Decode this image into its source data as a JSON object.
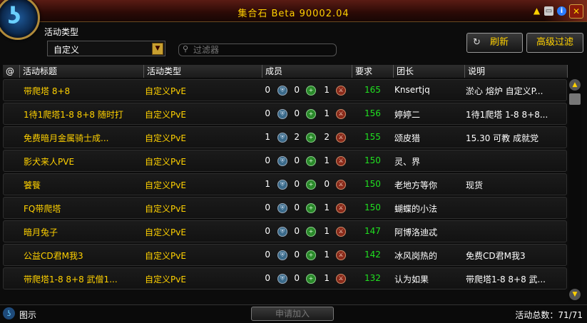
{
  "window": {
    "title": "集合石 Beta 90002.04",
    "close_label": "✕"
  },
  "header": {
    "activity_type_label": "活动类型",
    "dropdown_value": "自定义",
    "search_placeholder": "过滤器",
    "refresh_label": "刷新",
    "advanced_filter_label": "高级过滤"
  },
  "columns": [
    "@",
    "活动标题",
    "活动类型",
    "成员",
    "要求",
    "团长",
    "说明"
  ],
  "rows": [
    {
      "title": "带爬塔 8+8",
      "type": "自定义PvE",
      "tank": "0",
      "heal": "0",
      "dps": "1",
      "req": "165",
      "leader": "Knsertjq",
      "desc": "淤心 熔炉 自定义P..."
    },
    {
      "title": "1待1爬塔1-8 8+8 随时打",
      "type": "自定义PvE",
      "tank": "0",
      "heal": "0",
      "dps": "1",
      "req": "156",
      "leader": "婷婷二",
      "desc": "1待1爬塔 1-8 8+8..."
    },
    {
      "title": "免费暗月金属骑士成...",
      "type": "自定义PvE",
      "tank": "1",
      "heal": "2",
      "dps": "2",
      "req": "155",
      "leader": "颂皮猎",
      "desc": "15.30 可教 成就党"
    },
    {
      "title": "影犬来人PVE",
      "type": "自定义PvE",
      "tank": "0",
      "heal": "0",
      "dps": "1",
      "req": "150",
      "leader": "灵、界",
      "desc": ""
    },
    {
      "title": "饕餮",
      "type": "自定义PvE",
      "tank": "1",
      "heal": "0",
      "dps": "0",
      "req": "150",
      "leader": "老地方等你",
      "desc": "现货"
    },
    {
      "title": "FQ带爬塔",
      "type": "自定义PvE",
      "tank": "0",
      "heal": "0",
      "dps": "1",
      "req": "150",
      "leader": "蝴蝶的小法",
      "desc": ""
    },
    {
      "title": "暗月兔子",
      "type": "自定义PvE",
      "tank": "0",
      "heal": "0",
      "dps": "1",
      "req": "147",
      "leader": "阿博洛迪忒",
      "desc": ""
    },
    {
      "title": "公益CD君M我3",
      "type": "自定义PvE",
      "tank": "0",
      "heal": "0",
      "dps": "1",
      "req": "142",
      "leader": "冰风岗热的",
      "desc": "免费CD君M我3"
    },
    {
      "title": "带爬塔1-8 8+8 武僧1...",
      "type": "自定义PvE",
      "tank": "0",
      "heal": "0",
      "dps": "1",
      "req": "132",
      "leader": "认为如果",
      "desc": "带爬塔1-8 8+8 武..."
    }
  ],
  "footer": {
    "legend_label": "图示",
    "apply_label": "申请加入",
    "total_label": "活动总数：71/71"
  },
  "icons": {
    "tank": "shield-icon",
    "heal": "plus-icon",
    "dps": "sword-icon"
  },
  "colors": {
    "accent": "#ffd100",
    "requirement": "#20e020"
  }
}
